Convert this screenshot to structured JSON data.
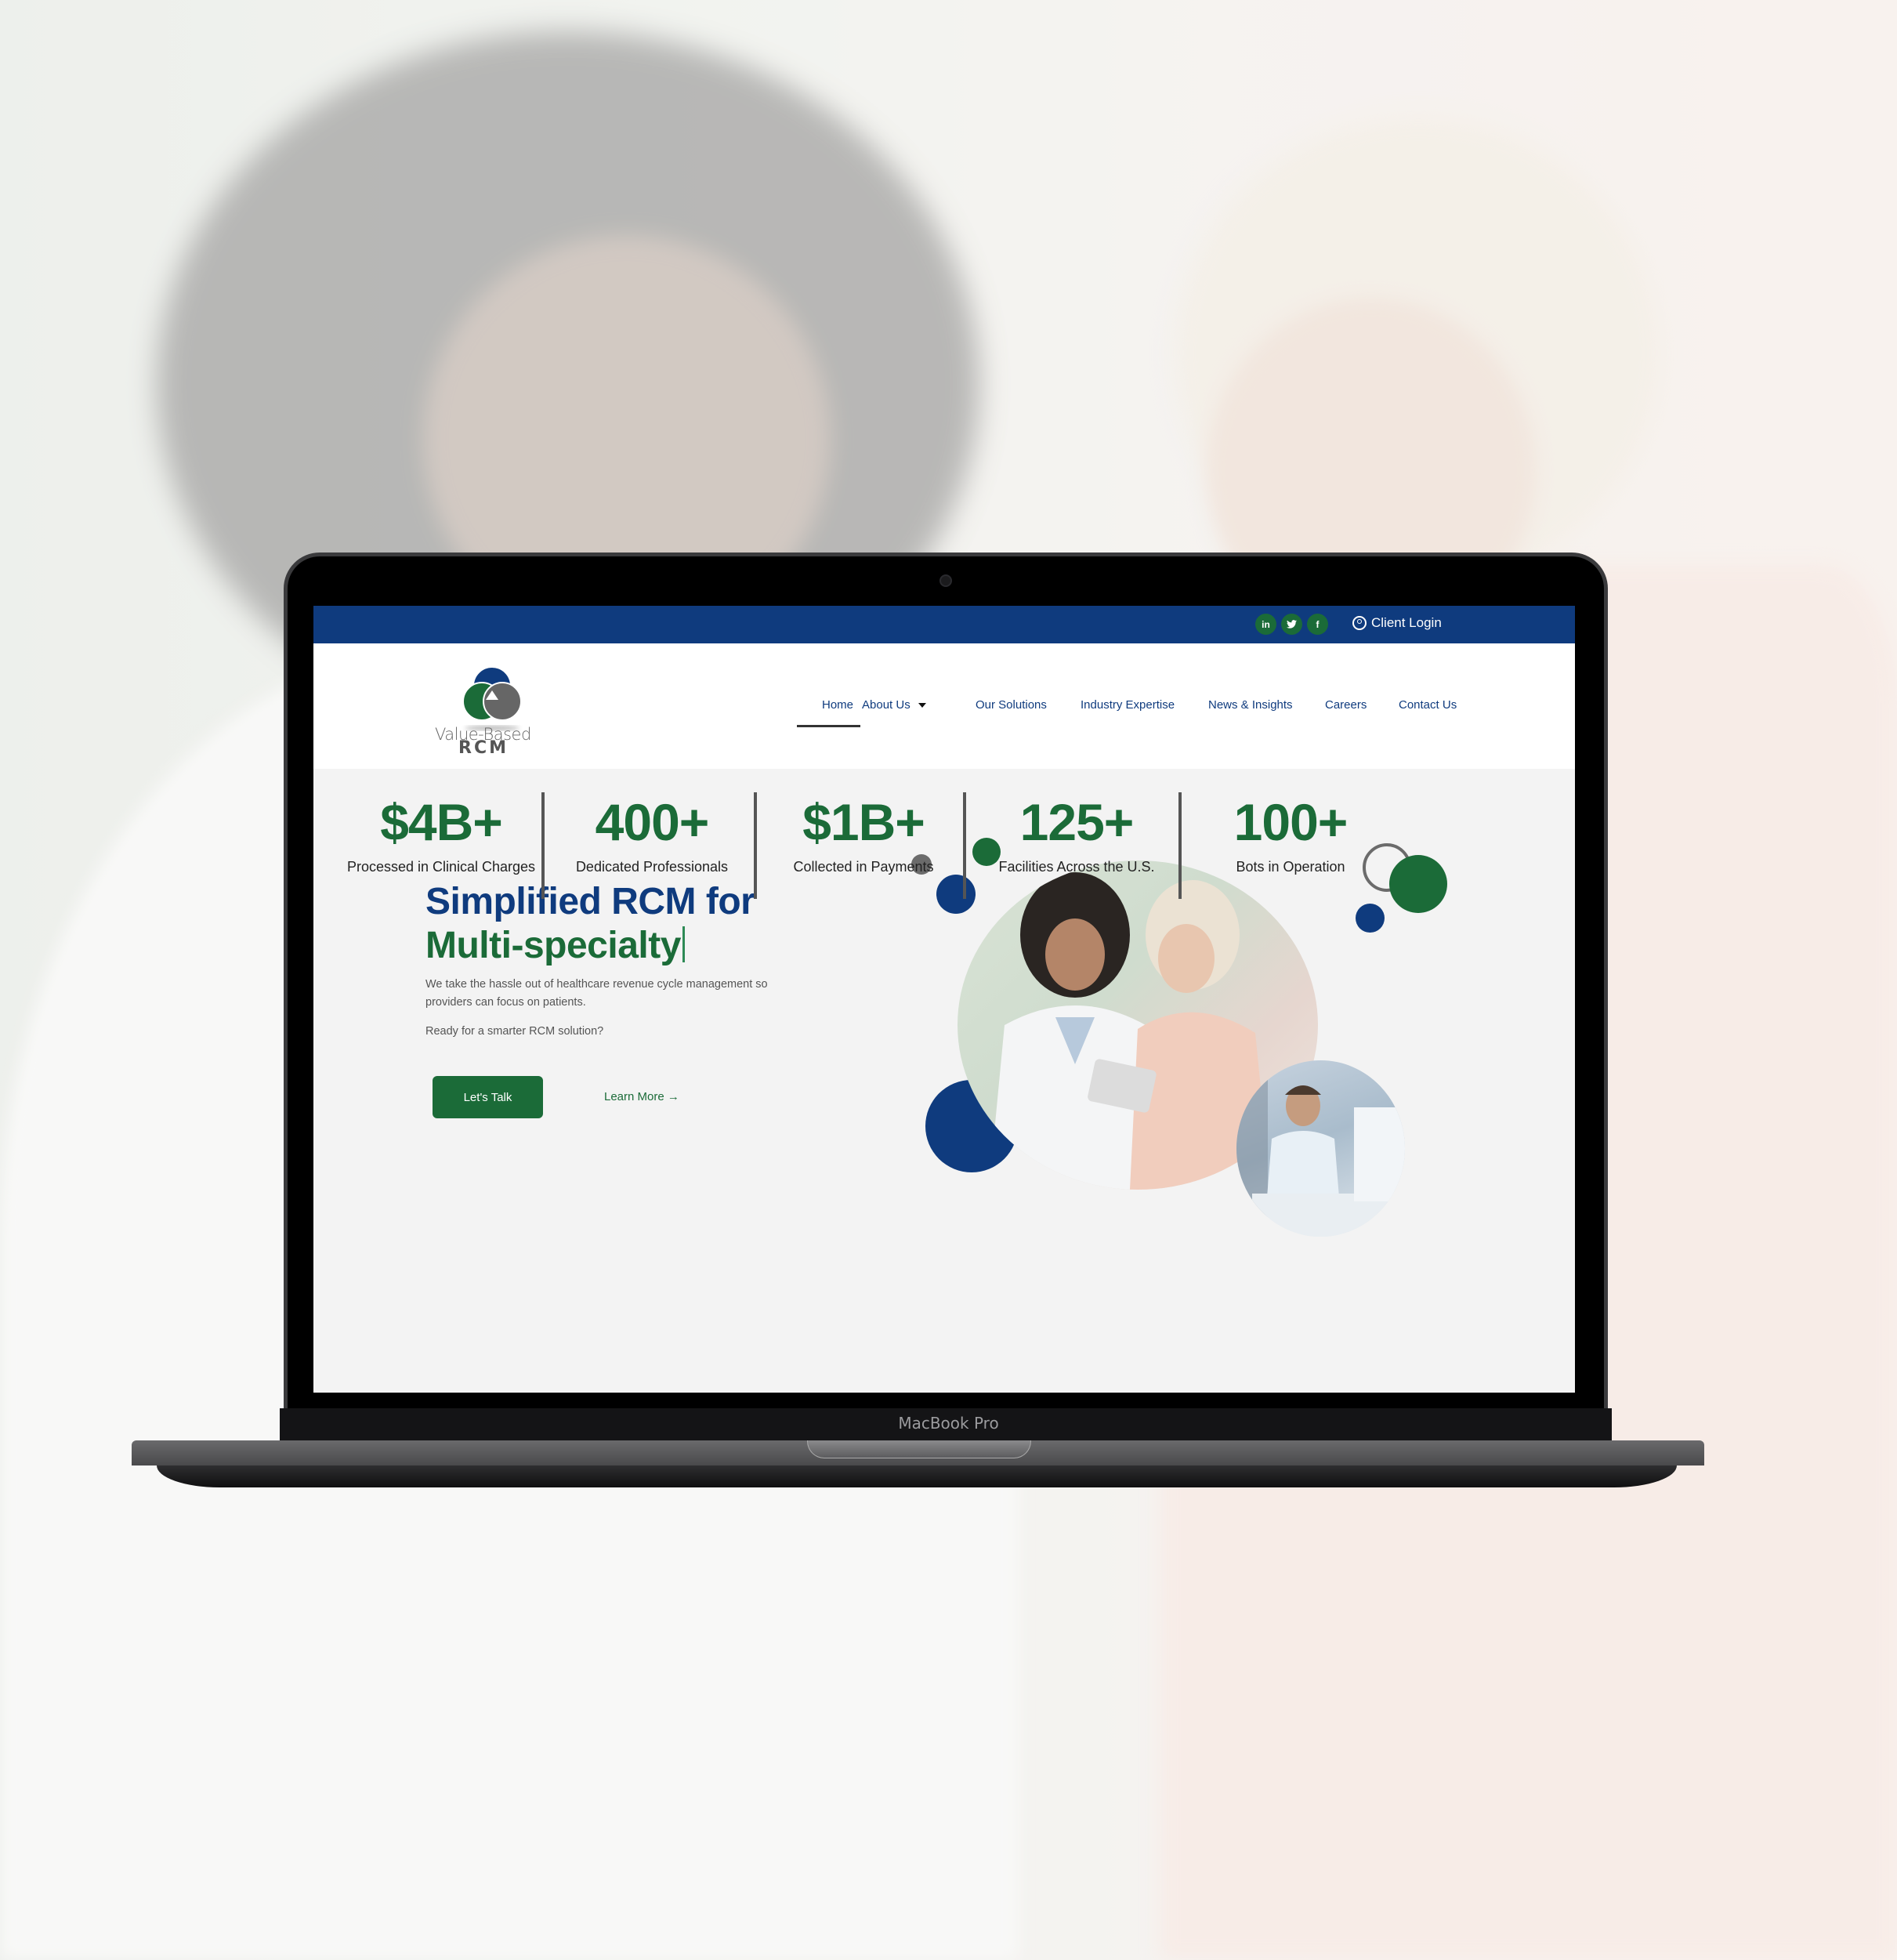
{
  "device": {
    "label": "MacBook Pro"
  },
  "topbar": {
    "social": [
      {
        "name": "linkedin",
        "glyph": "in"
      },
      {
        "name": "twitter",
        "glyph": "🐦"
      },
      {
        "name": "facebook",
        "glyph": "f"
      }
    ],
    "client_login": "Client Login",
    "color": "#0f3b7e"
  },
  "header": {
    "logo": {
      "line1": "Value-Based",
      "line2": "RCM"
    },
    "nav": [
      {
        "label": "Home",
        "active": true
      },
      {
        "label": "About Us",
        "has_dropdown": true
      },
      {
        "label": "Our Solutions"
      },
      {
        "label": "Industry Expertise"
      },
      {
        "label": "News & Insights"
      },
      {
        "label": "Careers"
      },
      {
        "label": "Contact Us"
      }
    ]
  },
  "hero": {
    "title_line1": "Simplified RCM for",
    "title_line2": "Multi-specialty",
    "subtitle": "We take the hassle out of healthcare revenue cycle management so providers can focus on patients.",
    "question": "Ready for a smarter RCM solution?",
    "primary_button": "Let's Talk",
    "secondary_link": "Learn More",
    "secondary_arrow": "→"
  },
  "stats": [
    {
      "value": "$4B+",
      "label": "Processed in Clinical Charges"
    },
    {
      "value": "400+",
      "label": "Dedicated Professionals"
    },
    {
      "value": "$1B+",
      "label": "Collected in Payments"
    },
    {
      "value": "125+",
      "label": "Facilities Across the U.S."
    },
    {
      "value": "100+",
      "label": "Bots in Operation"
    }
  ],
  "colors": {
    "brand_blue": "#0f3b7e",
    "brand_green": "#1b6b38",
    "brand_gray": "#6b6b6b",
    "hero_bg": "#f3f3f3"
  }
}
